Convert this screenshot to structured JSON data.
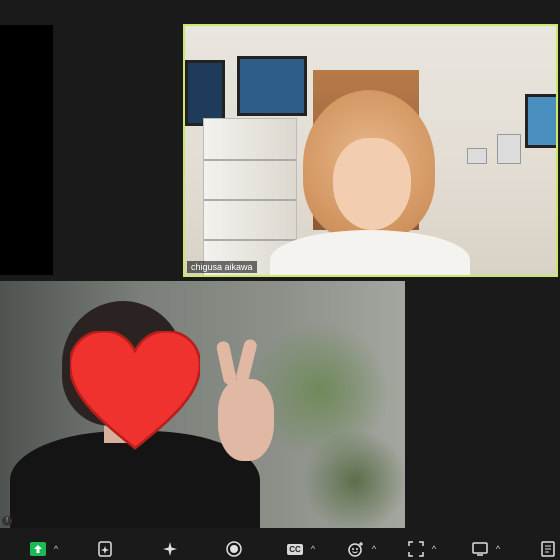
{
  "participants": {
    "speaker_name": "chigusa aikawa"
  },
  "colors": {
    "active_speaker_border": "#cbe86b",
    "share_button": "#1db954",
    "heart": "#f0322e"
  },
  "toolbar": {
    "items": [
      {
        "icon": "share-screen-icon",
        "caret": true
      },
      {
        "icon": "document-sparkle-icon",
        "caret": false
      },
      {
        "icon": "ai-sparkle-icon",
        "caret": false
      },
      {
        "icon": "record-icon",
        "caret": false
      },
      {
        "icon": "cc",
        "label": "CC",
        "caret": true
      },
      {
        "icon": "reactions-icon",
        "caret": true
      },
      {
        "icon": "focus-icon",
        "caret": true
      },
      {
        "icon": "screen-icon",
        "caret": true
      },
      {
        "icon": "more-icon",
        "caret": false
      }
    ]
  }
}
